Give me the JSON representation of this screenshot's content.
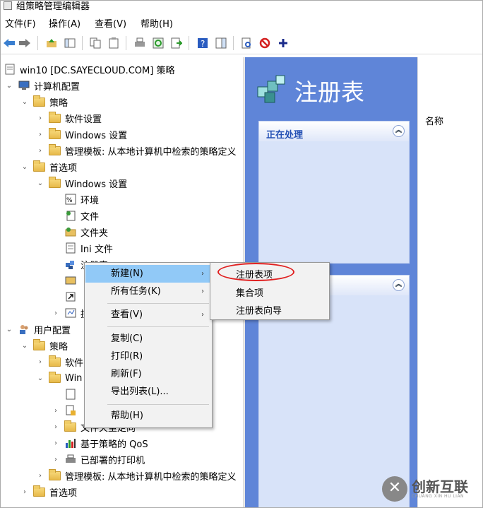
{
  "window": {
    "title": "组策略管理编辑器"
  },
  "menubar": {
    "items": [
      "文件(F)",
      "操作(A)",
      "查看(V)",
      "帮助(H)"
    ]
  },
  "tree": {
    "root": "win10 [DC.SAYECLOUD.COM] 策略",
    "computer_config": "计算机配置",
    "policies": "策略",
    "software_settings": "软件设置",
    "windows_settings": "Windows 设置",
    "admin_templates": "管理模板: 从本地计算机中检索的策略定义",
    "preferences": "首选项",
    "pref_windows_settings": "Windows 设置",
    "environment": "环境",
    "files": "文件",
    "folders": "文件夹",
    "ini_files": "Ini 文件",
    "registry": "注册表",
    "control_partial": "控制",
    "user_config": "用户配置",
    "user_policies": "策略",
    "user_software_partial": "软件",
    "user_windows_partial": "Win",
    "folder_redirection": "文件夹重定向",
    "qos": "基于策略的 QoS",
    "deployed_printers": "已部署的打印机",
    "user_admin_templates": "管理模板: 从本地计算机中检索的策略定义",
    "user_preferences": "首选项"
  },
  "right_pane": {
    "header_title": "注册表",
    "processing_label": "正在处理",
    "column_name": "名称"
  },
  "context_menu": {
    "items": [
      "新建(N)",
      "所有任务(K)",
      "查看(V)",
      "复制(C)",
      "打印(R)",
      "刷新(F)",
      "导出列表(L)...",
      "帮助(H)"
    ],
    "highlighted": "新建(N)"
  },
  "submenu": {
    "items": [
      "注册表项",
      "集合项",
      "注册表向导"
    ],
    "circled": "注册表项"
  },
  "watermark": {
    "main": "创新互联",
    "sub": "CHUANG XIN HU LIAN"
  },
  "colors": {
    "blue_pane": "#5f85d8",
    "highlight": "#91c9f7",
    "circle": "#e02020"
  }
}
